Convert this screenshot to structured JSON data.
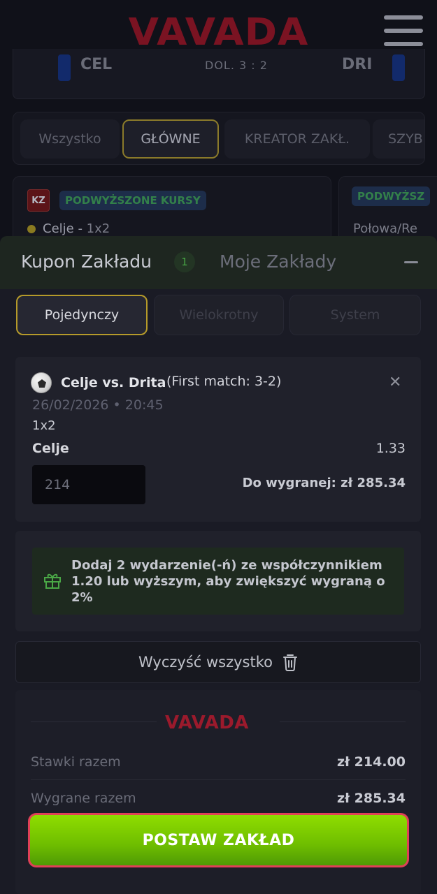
{
  "header": {
    "logo_text": "VAVADA",
    "menu_icon": "hamburger-menu-icon"
  },
  "match": {
    "home": "CEL",
    "away": "DRI",
    "score": "DOL. 3 : 2"
  },
  "filter_tabs": [
    {
      "label": "Wszystko",
      "active": false
    },
    {
      "label": "GŁÓWNE",
      "active": true
    },
    {
      "label": "KREATOR ZAKŁ.",
      "active": false
    },
    {
      "label": "SZYB",
      "active": false
    }
  ],
  "promo_cards": [
    {
      "badge": "KZ",
      "tag": "PODWYŻSZONE KURSY",
      "line_team": "Celje - ",
      "line_market": "1x2"
    },
    {
      "tag": "PODWYŻSZ",
      "line_text": "Połowa/Re"
    }
  ],
  "bet_slip": {
    "title": "Kupon Zakładu",
    "count": "1",
    "my_bets": "Moje Zakłady",
    "modes": [
      {
        "label": "Pojedynczy",
        "active": true
      },
      {
        "label": "Wielokrotny",
        "active": false
      },
      {
        "label": "System",
        "active": false
      }
    ],
    "bet": {
      "match": "Celje vs. Drita",
      "first_match": "(First match: 3-2)",
      "close_icon": "close-icon",
      "datetime": "26/02/2026 • 20:45",
      "market": "1x2",
      "selection": "Celje",
      "odds": "1.33",
      "stake": "214",
      "winnings": "Do wygranej: zł 285.34"
    },
    "bonus_text": "Dodaj 2 wydarzenie(-ń) ze współczynnikiem 1.20 lub wyższym, aby zwiększyć wygraną o 2%",
    "clear_all": "Wyczyść wszystko",
    "summary": {
      "logo_text": "VAVADA",
      "total_stakes_label": "Stawki razem",
      "total_stakes_value": "zł 214.00",
      "total_winnings_label": "Wygrane razem",
      "total_winnings_value": "zł 285.34"
    },
    "place_bet": "POSTAW ZAKŁAD"
  },
  "colors": {
    "accent_green": "#7ccf00",
    "active_border": "#b59a2a",
    "brand_red": "#9b1a2c",
    "place_bet_border": "#e04157"
  }
}
